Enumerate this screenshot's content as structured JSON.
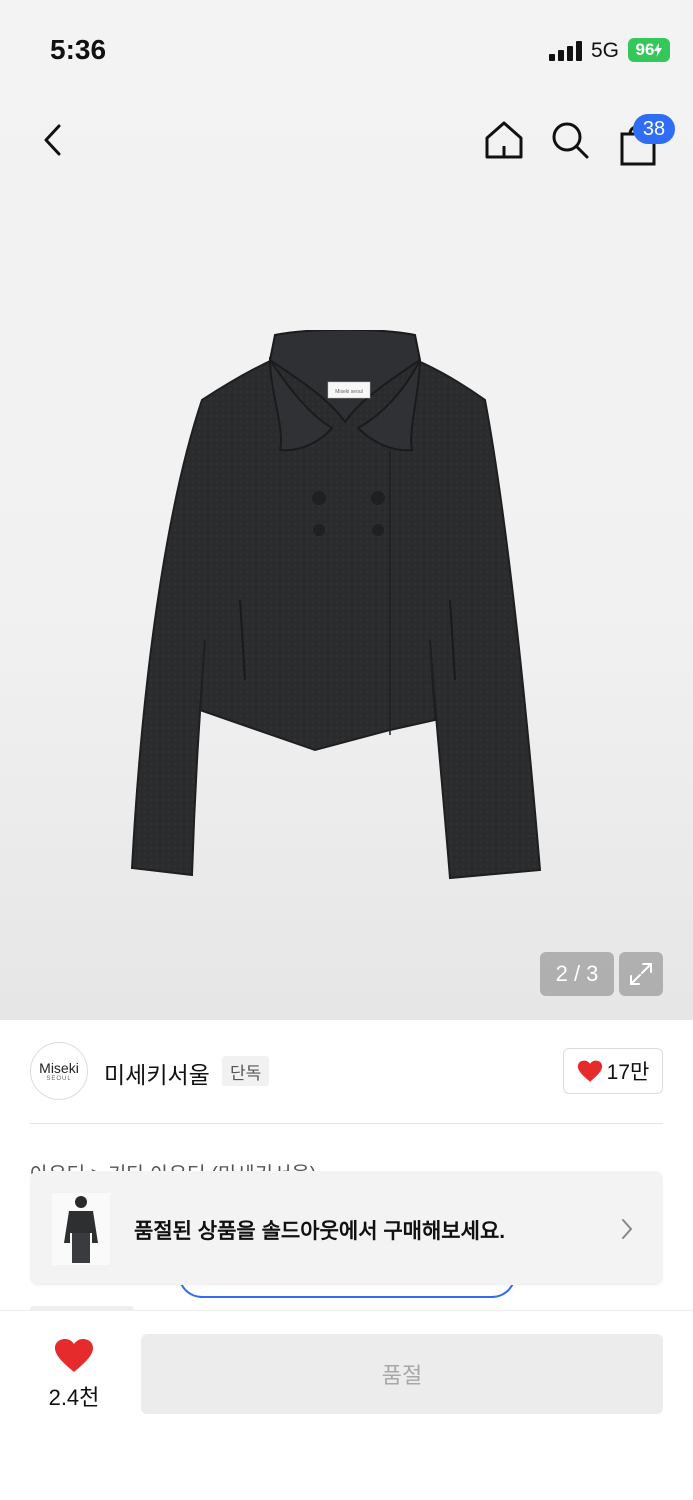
{
  "status_bar": {
    "time": "5:36",
    "network": "5G",
    "battery": "96"
  },
  "nav": {
    "cart_count": "38"
  },
  "product_image": {
    "label_text": "Miseki seoul"
  },
  "gallery": {
    "pager": "2 / 3"
  },
  "brand": {
    "logo_line1": "Miseki",
    "logo_line2": "SEOUL",
    "name": "미세키서울",
    "exclusive_badge": "단독",
    "likes": "17만"
  },
  "breadcrumb": "아우터 > 기타 아우터 (미세키서울)",
  "soldout_banner": {
    "text": "품절된 상품을 솔드아웃에서 구매해보세요."
  },
  "bottom": {
    "like_count": "2.4천",
    "buy_button": "품절"
  },
  "colors": {
    "accent_blue": "#2f6df6",
    "heart_red": "#e52b2b",
    "battery_green": "#34c759"
  }
}
